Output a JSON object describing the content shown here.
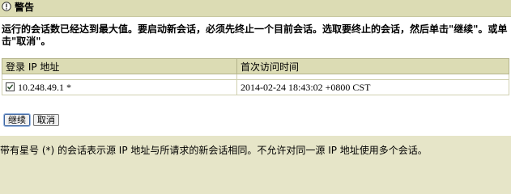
{
  "header": {
    "title": "警告",
    "icon": "warning-icon"
  },
  "message": {
    "line1": "运行的会话数已经达到最大值。要启动新会话，必须先终止一个目前会话。选取要终止的会话，然后单击\"继续\"。或单",
    "line2": "击\"取消\"。"
  },
  "table": {
    "headers": [
      "登录 IP 地址",
      "首次访问时间"
    ],
    "rows": [
      {
        "checked": true,
        "ip": "10.248.49.1 *",
        "time": "2014-02-24 18:43:02 +0800 CST"
      }
    ]
  },
  "buttons": {
    "continue_label": "继续",
    "cancel_label": "取消"
  },
  "footnote": "带有星号 (*) 的会话表示源 IP 地址与所请求的新会话相同。不允许对同一源 IP 地址使用多个会话。",
  "colors": {
    "background": "#e6e5c8",
    "header": "#dcdcb4",
    "panel": "#ffffff"
  }
}
